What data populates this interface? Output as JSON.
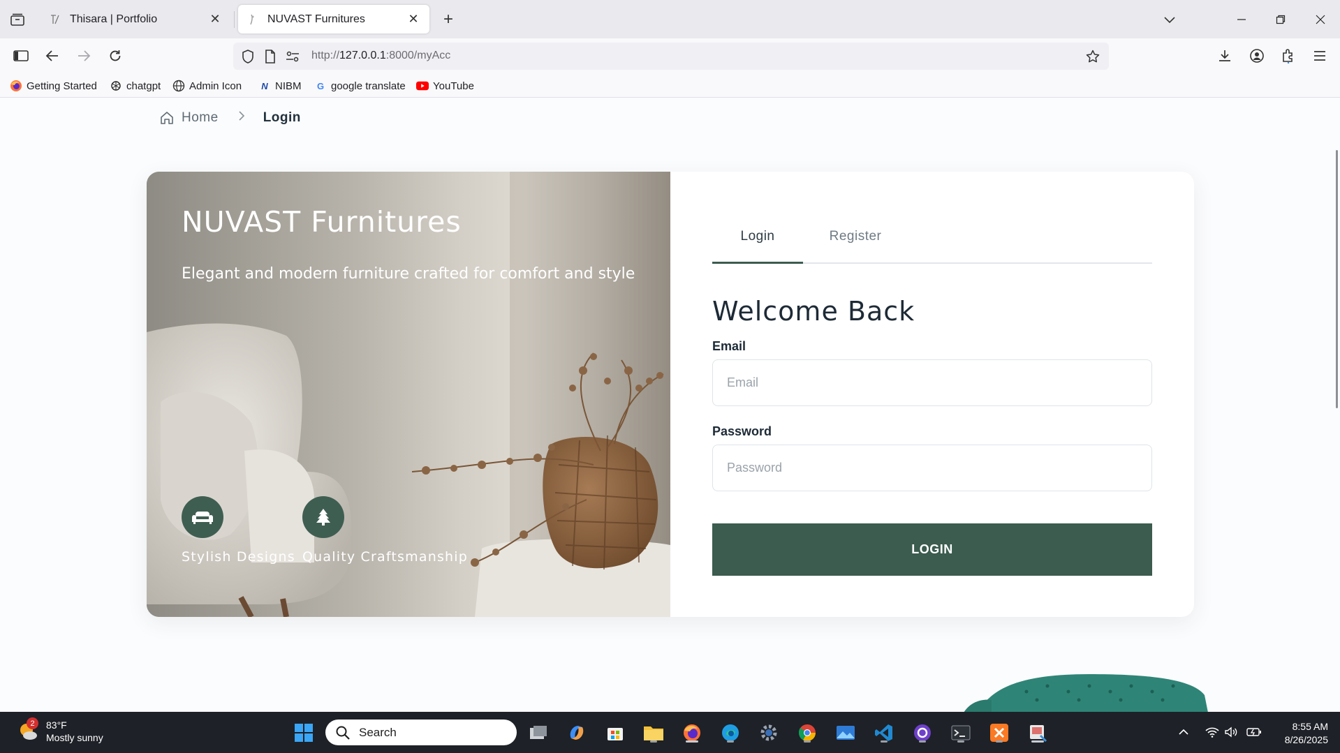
{
  "browser": {
    "tabs": [
      {
        "title": "Thisara | Portfolio",
        "active": false
      },
      {
        "title": "NUVAST Furnitures",
        "active": true
      }
    ],
    "url_scheme": "http://",
    "url_host": "127.0.0.1",
    "url_rest": ":8000/myAcc",
    "bookmarks": [
      {
        "label": "Getting Started",
        "icon": "firefox-icon"
      },
      {
        "label": "chatgpt",
        "icon": "openai-icon"
      },
      {
        "label": "Admin Icon",
        "icon": "globe-icon"
      },
      {
        "label": "NIBM",
        "icon": "nibm-icon"
      },
      {
        "label": "google translate",
        "icon": "google-icon"
      },
      {
        "label": "YouTube",
        "icon": "youtube-icon"
      }
    ]
  },
  "page": {
    "breadcrumb": {
      "home": "Home",
      "current": "Login"
    },
    "hero": {
      "title": "NUVAST Furnitures",
      "subtitle": "Elegant and modern furniture crafted for comfort and style",
      "features": [
        {
          "label": "Stylish Designs",
          "icon": "sofa-icon"
        },
        {
          "label": "Quality Craftsmanship",
          "icon": "tree-icon"
        }
      ]
    },
    "form": {
      "tabs": {
        "login": "Login",
        "register": "Register"
      },
      "heading": "Welcome Back",
      "email_label": "Email",
      "email_placeholder": "Email",
      "password_label": "Password",
      "password_placeholder": "Password",
      "submit": "LOGIN"
    }
  },
  "taskbar": {
    "weather": {
      "temp": "83°F",
      "desc": "Mostly sunny",
      "badge": "2"
    },
    "search_placeholder": "Search",
    "clock": {
      "time": "8:55 AM",
      "date": "8/26/2025"
    }
  },
  "colors": {
    "accent": "#3b5c4f",
    "taskbar": "#1e2127",
    "tabstrip": "#eaeaee"
  }
}
